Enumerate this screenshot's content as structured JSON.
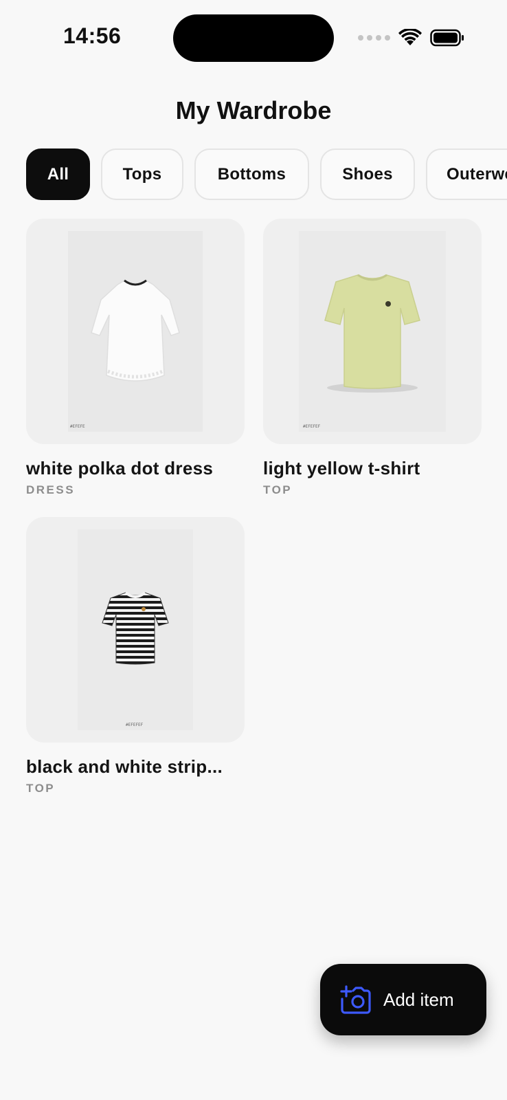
{
  "status_bar": {
    "time": "14:56"
  },
  "page": {
    "title": "My Wardrobe"
  },
  "filters": [
    {
      "label": "All",
      "active": true
    },
    {
      "label": "Tops",
      "active": false
    },
    {
      "label": "Bottoms",
      "active": false
    },
    {
      "label": "Shoes",
      "active": false
    },
    {
      "label": "Outerwear",
      "active": false
    }
  ],
  "items": [
    {
      "name": "white polka dot dress",
      "category": "DRESS",
      "photo_tag": "#EFEFE",
      "color": "#ffffff"
    },
    {
      "name": "light yellow t-shirt",
      "category": "TOP",
      "photo_tag": "#EFEFEF",
      "color": "#d8dea0"
    },
    {
      "name": "black and white strip...",
      "category": "TOP",
      "photo_tag": "#EFEFEF",
      "color": "#222222"
    }
  ],
  "actions": {
    "add_item_label": "Add item",
    "accent_color": "#3d5afe"
  }
}
